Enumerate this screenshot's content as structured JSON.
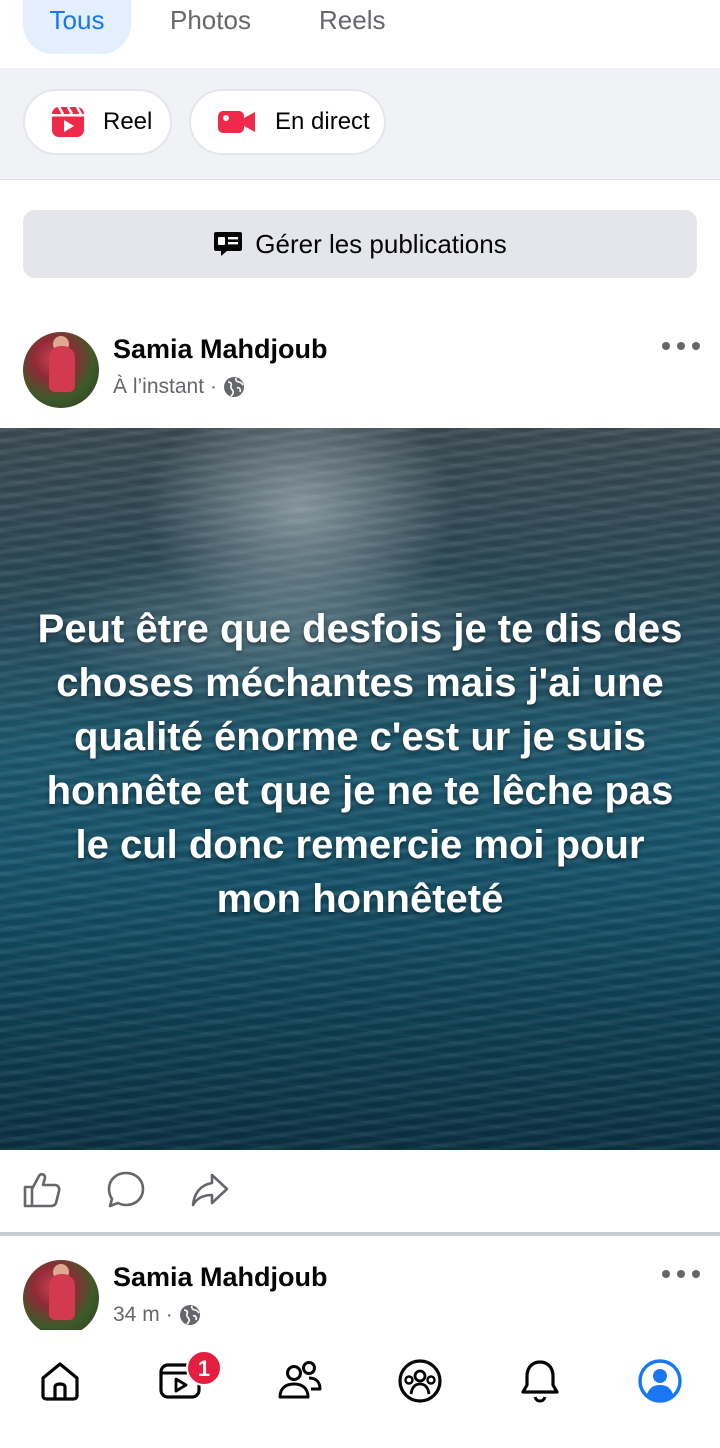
{
  "tabs": {
    "all": "Tous",
    "photos": "Photos",
    "reels": "Reels"
  },
  "create": {
    "reel_label": "Reel",
    "live_label": "En direct"
  },
  "manage_label": "Gérer les publications",
  "posts": [
    {
      "author": "Samia Mahdjoub",
      "time": "À l’instant",
      "separator": "·",
      "privacy_icon": "globe-icon",
      "text": "Peut être que desfois je te dis des choses méchantes mais j'ai une qualité énorme c'est ur je suis honnête et que je ne te lêche pas le cul donc remercie moi pour mon honnêteté"
    },
    {
      "author": "Samia Mahdjoub",
      "time": "34 m",
      "separator": "·",
      "privacy_icon": "globe-icon"
    }
  ],
  "actions": [
    "like-icon",
    "comment-icon",
    "share-icon"
  ],
  "nav": {
    "items": [
      "home-icon",
      "video-icon",
      "friends-icon",
      "groups-icon",
      "bell-icon",
      "profile-icon"
    ],
    "video_badge": "1"
  },
  "colors": {
    "accent": "#1877f2",
    "tab_active_bg": "#e3effd",
    "badge": "#e41e3f",
    "reel_icon": "#f02849",
    "live_icon": "#f02849",
    "secondary_text": "#65676b"
  }
}
